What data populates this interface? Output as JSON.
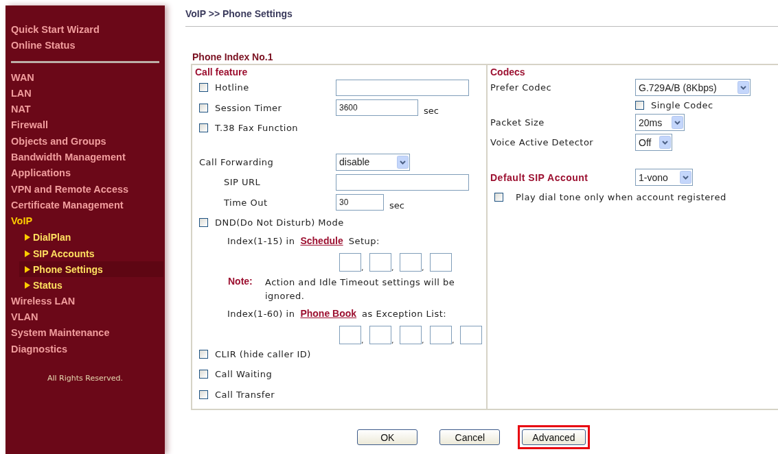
{
  "sidebar": {
    "top_items": [
      {
        "label": "Quick Start Wizard"
      },
      {
        "label": "Online Status"
      }
    ],
    "items": [
      {
        "label": "WAN",
        "expanded": false
      },
      {
        "label": "LAN",
        "expanded": false
      },
      {
        "label": "NAT",
        "expanded": false
      },
      {
        "label": "Firewall",
        "expanded": false
      },
      {
        "label": "Objects and Groups",
        "expanded": false
      },
      {
        "label": "Bandwidth Management",
        "expanded": false
      },
      {
        "label": "Applications",
        "expanded": false
      },
      {
        "label": "VPN and Remote Access",
        "expanded": false
      },
      {
        "label": "Certificate Management",
        "expanded": false
      },
      {
        "label": "VoIP",
        "expanded": true,
        "children": [
          {
            "label": "DialPlan",
            "selected": false
          },
          {
            "label": "SIP Accounts",
            "selected": false
          },
          {
            "label": "Phone Settings",
            "selected": true
          },
          {
            "label": "Status",
            "selected": false
          }
        ]
      },
      {
        "label": "Wireless LAN",
        "expanded": false
      },
      {
        "label": "VLAN",
        "expanded": false
      },
      {
        "label": "System Maintenance",
        "expanded": false
      },
      {
        "label": "Diagnostics",
        "expanded": false
      }
    ],
    "footer": "All Rights Reserved."
  },
  "page_title": "VoIP >> Phone Settings",
  "section_title": "Phone Index No.1",
  "call_feature": {
    "title": "Call feature",
    "groups": [
      [
        {
          "kind": "check",
          "label": "Hotline",
          "checked": false,
          "has_field": true
        },
        {
          "kind": "check",
          "label": "Session Timer",
          "checked": false,
          "has_field": true,
          "value": "3600",
          "unit": "sec"
        },
        {
          "kind": "check",
          "label": "T.38 Fax Function",
          "checked": false,
          "has_field": false
        }
      ],
      [
        {
          "kind": "select",
          "label": "Call Forwarding",
          "value": "disable"
        },
        {
          "kind": "field",
          "label": "SIP URL"
        },
        {
          "kind": "field",
          "label": "Time Out",
          "value": "30",
          "unit": "sec"
        },
        {
          "kind": "check",
          "label": "DND(Do Not Disturb) Mode",
          "checked": false,
          "has_field": false
        },
        {
          "kind": "index",
          "before": "Index(1-15) in",
          "link": "Schedule",
          "after": "Setup:",
          "separator": ",",
          "fields": [
            {
              "kind": "empty"
            },
            {
              "kind": "empty"
            },
            {
              "kind": "empty"
            },
            {
              "kind": "empty"
            }
          ]
        },
        {
          "kind": "note",
          "label": "Note:",
          "text": "Action and Idle Timeout settings will be ignored."
        },
        {
          "kind": "index",
          "before": "Index(1-60) in",
          "link": "Phone Book",
          "after": "as Exception List:",
          "separator": ",",
          "fields": [
            {
              "kind": "empty"
            },
            {
              "kind": "empty"
            },
            {
              "kind": "empty"
            },
            {
              "kind": "empty"
            },
            {
              "kind": "empty"
            }
          ]
        },
        {
          "kind": "check",
          "label": "CLIR (hide caller ID)",
          "checked": false,
          "has_field": false
        },
        {
          "kind": "check",
          "label": "Call Waiting",
          "checked": false,
          "has_field": false
        },
        {
          "kind": "check",
          "label": "Call Transfer",
          "checked": false,
          "has_field": false
        }
      ]
    ]
  },
  "codecs": {
    "title": "Codecs",
    "rows": [
      {
        "kind": "select",
        "label": "Prefer Codec",
        "value": "G.729A/B (8Kbps)"
      },
      {
        "kind": "subcheck",
        "label": "Single Codec",
        "checked": false
      },
      {
        "kind": "select",
        "label": "Packet Size",
        "value": "20ms"
      },
      {
        "kind": "select",
        "label": "Voice Active Detector",
        "value": "Off"
      }
    ]
  },
  "default_sip_account": {
    "label": "Default SIP Account",
    "value": "1-vono",
    "option": {
      "label": "Play dial tone only when account registered",
      "checked": false
    }
  },
  "buttons": [
    {
      "label": "OK",
      "highlighted": false
    },
    {
      "label": "Cancel",
      "highlighted": false
    },
    {
      "label": "Advanced",
      "highlighted": true
    }
  ]
}
